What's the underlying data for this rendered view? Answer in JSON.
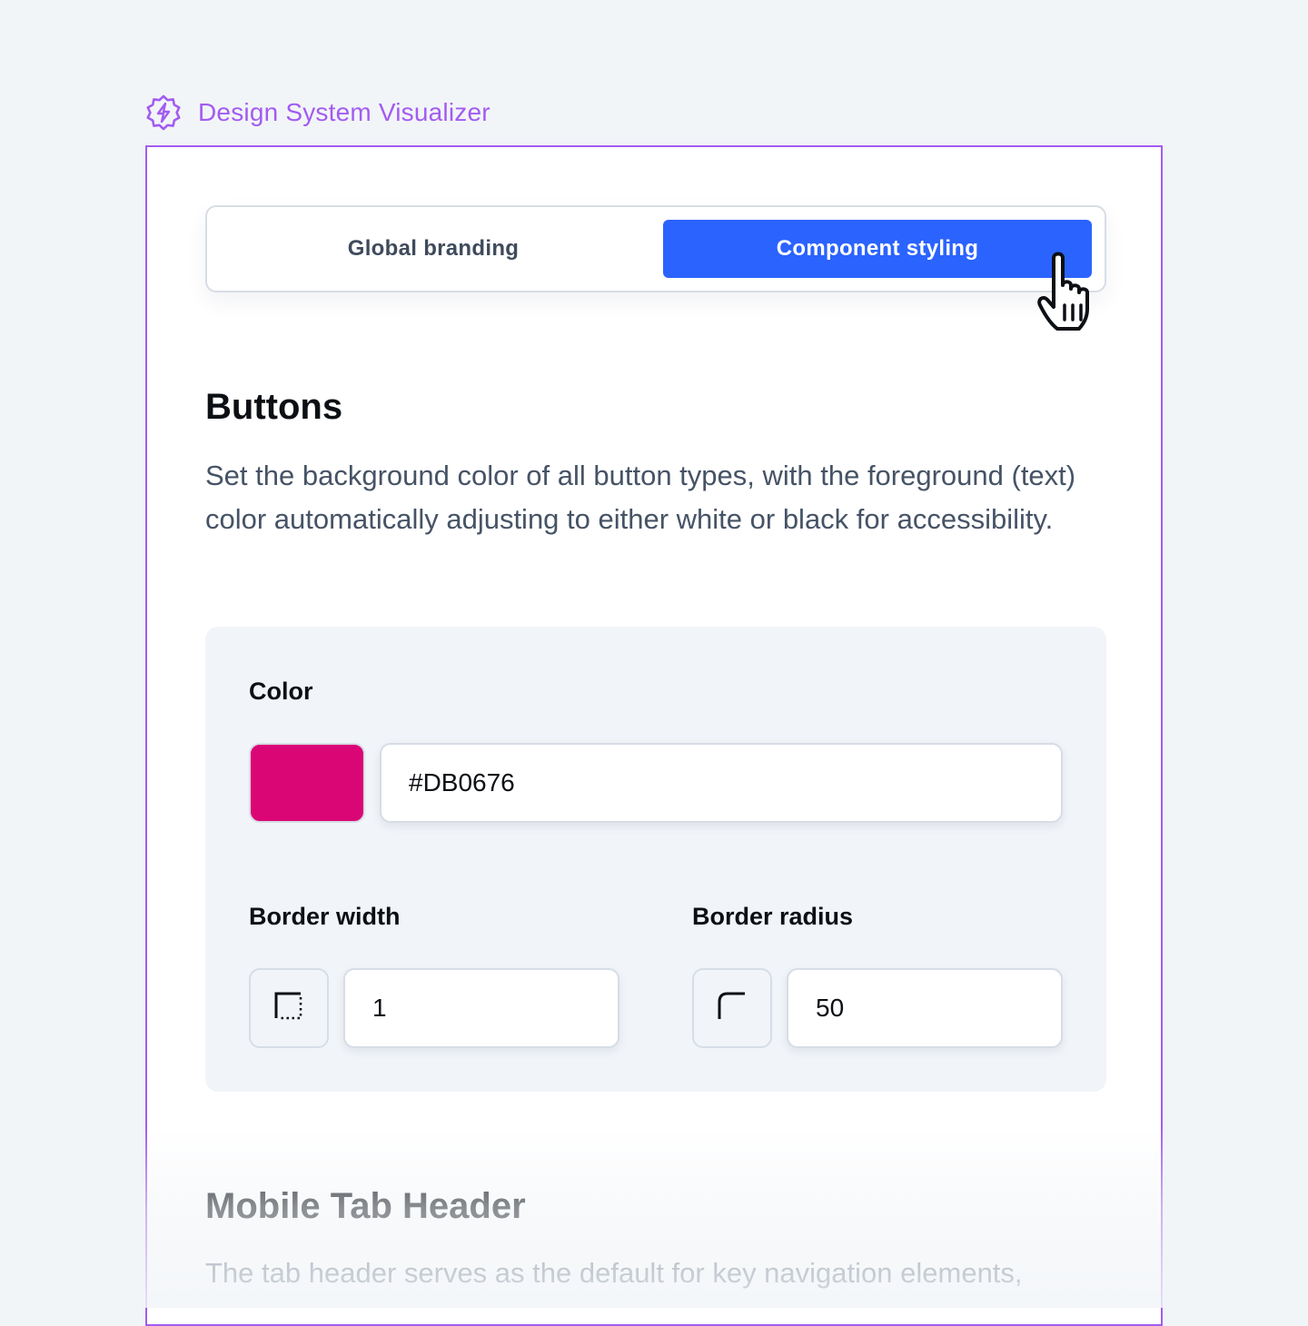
{
  "app": {
    "title": "Design System Visualizer",
    "logo_icon": "lightning-badge-icon",
    "accent_color": "#a25cf0"
  },
  "tabs": [
    {
      "label": "Global branding",
      "active": false
    },
    {
      "label": "Component styling",
      "active": true
    }
  ],
  "buttons_section": {
    "title": "Buttons",
    "description": "Set the background color of all button types, with the foreground (text) color automatically adjusting to either white or black for accessibility.",
    "color": {
      "label": "Color",
      "swatch": "#DB0676",
      "value": "#DB0676"
    },
    "border_width": {
      "label": "Border width",
      "icon": "border-width-icon",
      "value": "1"
    },
    "border_radius": {
      "label": "Border radius",
      "icon": "border-radius-icon",
      "value": "50"
    }
  },
  "mobile_tab_section": {
    "title": "Mobile Tab Header",
    "description": "The tab header serves as the default for key navigation elements,"
  },
  "colors": {
    "active_tab": "#2b63ff",
    "panel_bg": "#f1f4f8"
  },
  "cursor_icon": "pointer-hand-icon"
}
